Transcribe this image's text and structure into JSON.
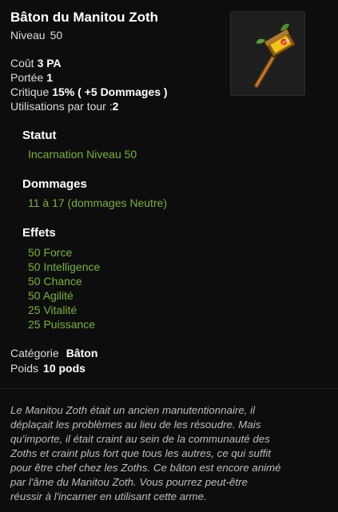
{
  "item": {
    "name": "Bâton du Manitou Zoth",
    "level_label": "Niveau",
    "level_value": "50",
    "icon": "staff-icon"
  },
  "stats": {
    "cost_label": "Coût",
    "cost_value": "3 PA",
    "range_label": "Portée",
    "range_value": "1",
    "crit_label": "Critique",
    "crit_value": "15% ( +5 Dommages )",
    "uses_label": "Utilisations par tour :",
    "uses_value": "2"
  },
  "status": {
    "heading": "Statut",
    "value": "Incarnation Niveau 50"
  },
  "damage": {
    "heading": "Dommages",
    "value": "11 à 17 (dommages Neutre)"
  },
  "effects": {
    "heading": "Effets",
    "items": [
      "50 Force",
      "50 Intelligence",
      "50 Chance",
      "50 Agilité",
      "25 Vitalité",
      "25 Puissance"
    ]
  },
  "meta": {
    "category_label": "Catégorie",
    "category_value": "Bâton",
    "weight_label": "Poids",
    "weight_value": "10 pods"
  },
  "description": {
    "lines": [
      "Le Manitou Zoth était un ancien manutentionnaire, il",
      "déplaçait les problèmes au lieu de les résoudre. Mais",
      "qu'importe, il était craint au sein de la communauté des",
      "Zoths et craint plus fort que tous les autres, ce qui suffit",
      "pour être chef chez les Zoths. Ce bâton est encore animé",
      "par l'âme du Manitou Zoth. Vous pourrez peut-être",
      "réussir à l'incarner en utilisant cette arme."
    ]
  },
  "colors": {
    "background": "#0d0d0d",
    "effect_green": "#79b23a"
  }
}
